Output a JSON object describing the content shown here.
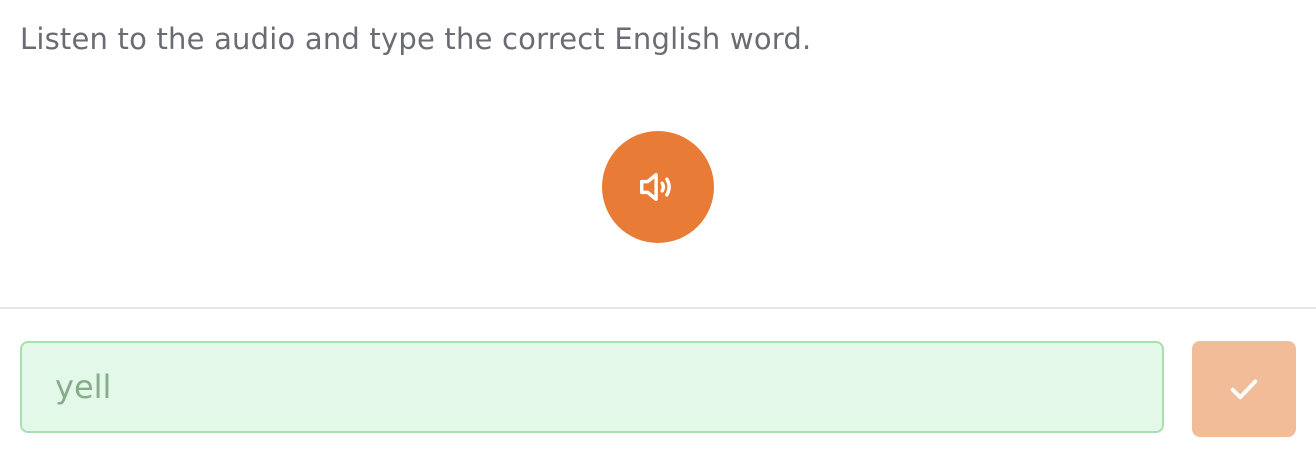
{
  "instruction": "Listen to the audio and type the correct English word.",
  "audio_button": {
    "icon": "speaker-icon",
    "color": "#e87b35"
  },
  "answer": {
    "value": "yell",
    "state": "correct",
    "border_color": "#a8e0b0",
    "background_color": "#e3f8e8"
  },
  "submit_button": {
    "icon": "checkmark-icon",
    "color": "#f2bc98"
  }
}
